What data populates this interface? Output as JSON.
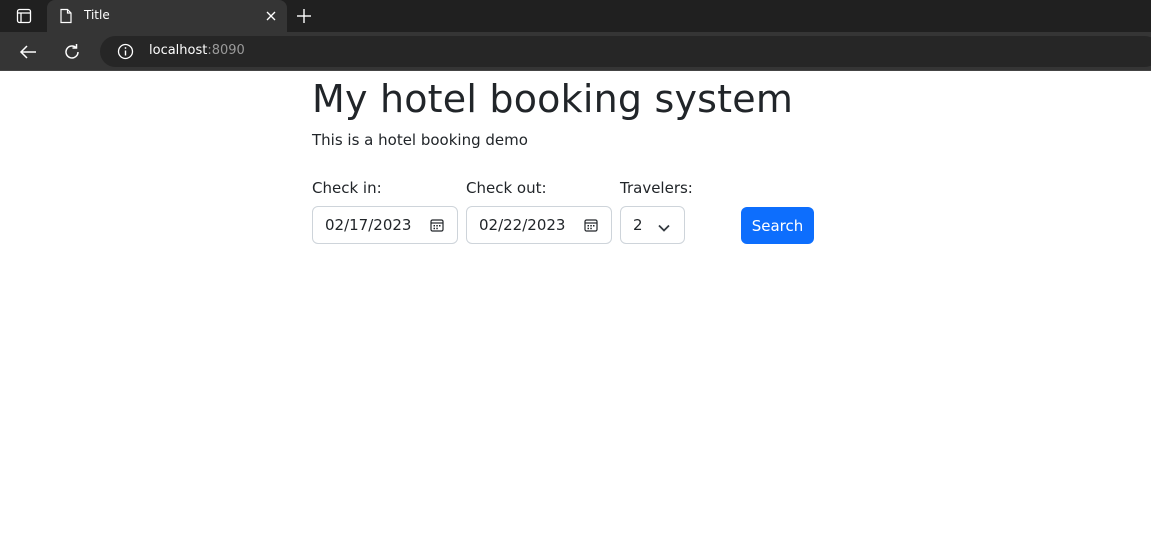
{
  "browser": {
    "tab_title": "Title",
    "url_host": "localhost",
    "url_port": ":8090"
  },
  "page": {
    "title": "My hotel booking system",
    "subtitle": "This is a hotel booking demo"
  },
  "form": {
    "check_in_label": "Check in:",
    "check_in_value": "02/17/2023",
    "check_out_label": "Check out:",
    "check_out_value": "02/22/2023",
    "travelers_label": "Travelers:",
    "travelers_value": "2",
    "search_label": "Search"
  },
  "colors": {
    "primary_button": "#0d6efd",
    "text": "#212529"
  },
  "icons": [
    "sidebar-toggle-icon",
    "document-icon",
    "close-icon",
    "plus-icon",
    "back-arrow-icon",
    "reload-icon",
    "info-icon",
    "calendar-icon",
    "chevron-down-icon"
  ]
}
